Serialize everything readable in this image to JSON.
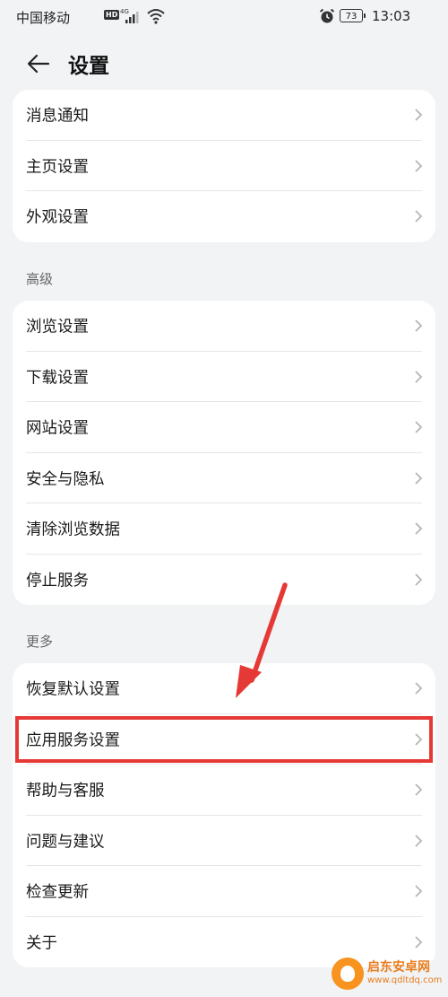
{
  "status_bar": {
    "carrier": "中国移动",
    "hd": "HD",
    "network": "4G",
    "battery": "73",
    "time": "13:03"
  },
  "header": {
    "title": "设置"
  },
  "groups": [
    {
      "label": "",
      "items": [
        "消息通知",
        "主页设置",
        "外观设置"
      ]
    },
    {
      "label": "高级",
      "items": [
        "浏览设置",
        "下载设置",
        "网站设置",
        "安全与隐私",
        "清除浏览数据",
        "停止服务"
      ]
    },
    {
      "label": "更多",
      "items": [
        "恢复默认设置",
        "应用服务设置",
        "帮助与客服",
        "问题与建议",
        "检查更新",
        "关于"
      ]
    }
  ],
  "highlighted_item": "应用服务设置",
  "watermark": {
    "name": "启东安卓网",
    "url": "www.qdltdq.com"
  },
  "colors": {
    "background": "#f1f3f5",
    "card": "#ffffff",
    "highlight": "#e53935",
    "watermark": "#f7931e"
  },
  "icons": {
    "back": "back-arrow-icon",
    "chevron": "chevron-right-icon"
  }
}
